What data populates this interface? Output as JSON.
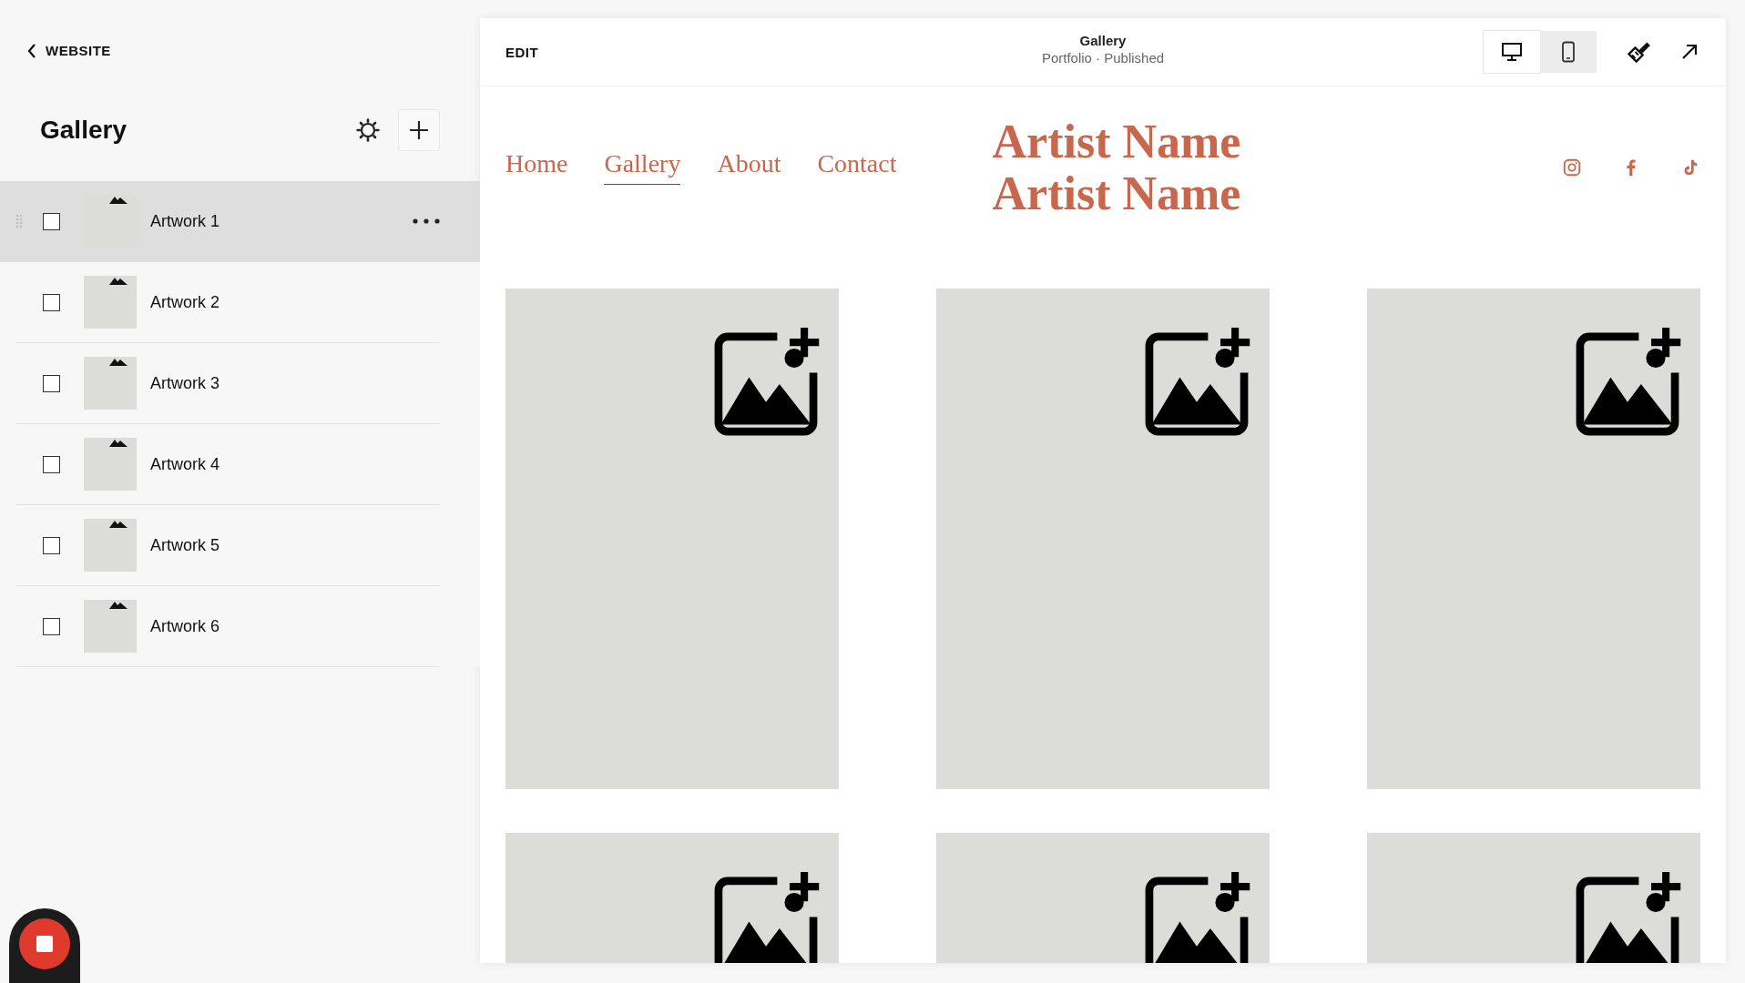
{
  "sidebar": {
    "back_link": "WEBSITE",
    "title": "Gallery",
    "items": [
      {
        "label": "Artwork 1",
        "highlighted": true,
        "checked": false
      },
      {
        "label": "Artwork 2",
        "highlighted": false,
        "checked": false
      },
      {
        "label": "Artwork 3",
        "highlighted": false,
        "checked": false
      },
      {
        "label": "Artwork 4",
        "highlighted": false,
        "checked": false
      },
      {
        "label": "Artwork 5",
        "highlighted": false,
        "checked": false
      },
      {
        "label": "Artwork 6",
        "highlighted": false,
        "checked": false
      }
    ]
  },
  "toolbar": {
    "mode": "EDIT",
    "page_title": "Gallery",
    "page_status": "Portfolio · Published",
    "devices": [
      {
        "kind": "desktop",
        "selected": true
      },
      {
        "kind": "mobile",
        "selected": false
      }
    ]
  },
  "site": {
    "nav": [
      {
        "label": "Home",
        "selected": false
      },
      {
        "label": "Gallery",
        "selected": true
      },
      {
        "label": "About",
        "selected": false
      },
      {
        "label": "Contact",
        "selected": false
      }
    ],
    "logo_lines": [
      "Artist Name",
      "Artist Name"
    ],
    "social": [
      {
        "kind": "instagram"
      },
      {
        "kind": "facebook"
      },
      {
        "kind": "tiktok"
      }
    ],
    "tiles": [
      {
        "kind": "placeholder"
      },
      {
        "kind": "placeholder"
      },
      {
        "kind": "placeholder"
      },
      {
        "kind": "placeholder"
      },
      {
        "kind": "placeholder"
      },
      {
        "kind": "placeholder"
      }
    ]
  }
}
